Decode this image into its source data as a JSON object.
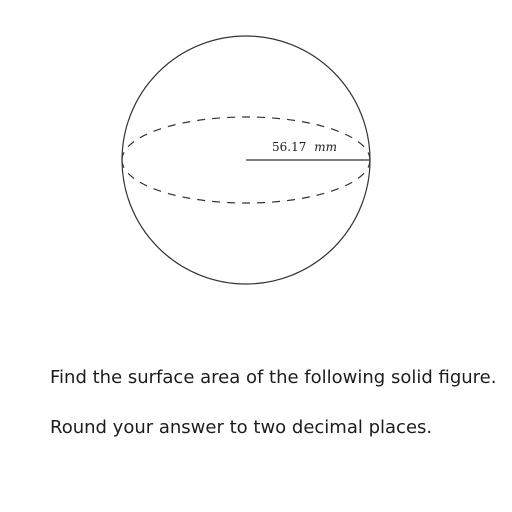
{
  "figure": {
    "shape": "sphere",
    "radius_value": "56.17",
    "radius_unit": "mm",
    "outline_color": "#333333"
  },
  "question": {
    "line1": "Find the surface area of the following solid figure.",
    "line2": "Round your answer to two decimal places."
  }
}
